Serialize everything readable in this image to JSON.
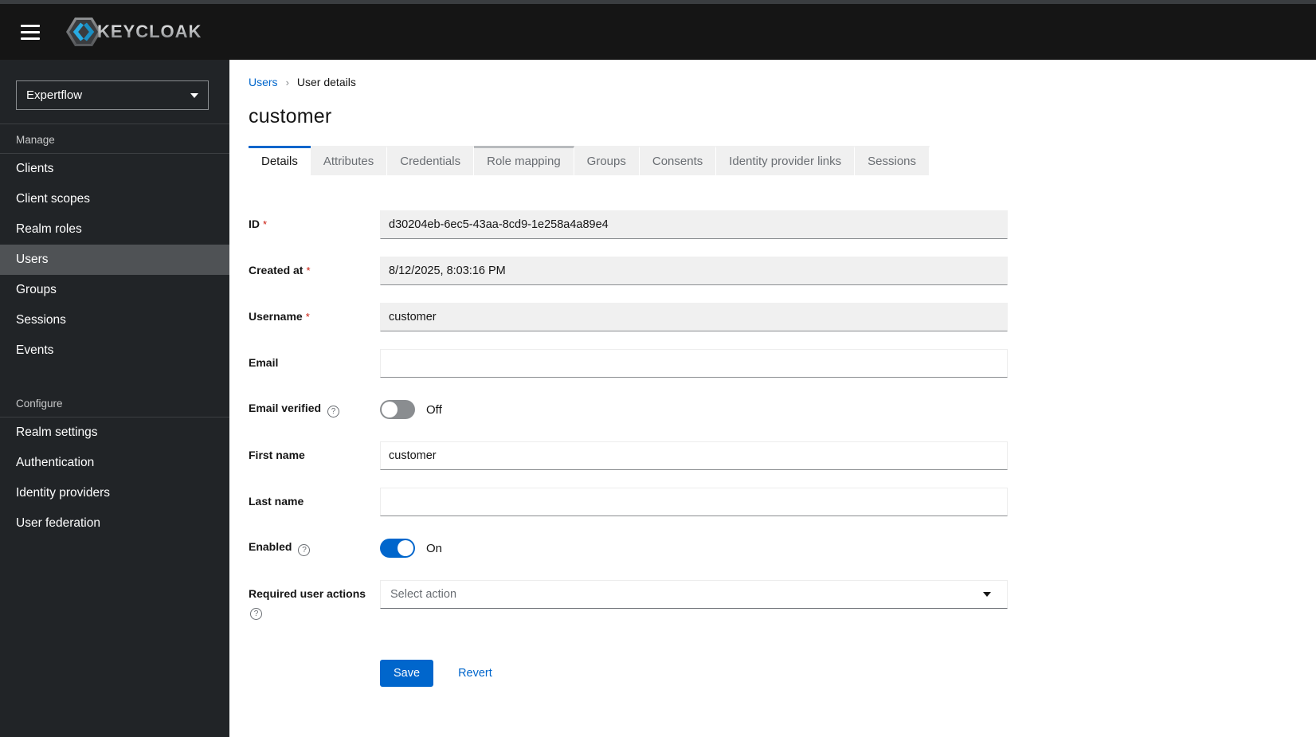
{
  "header": {
    "brand": "KEYCLOAK"
  },
  "sidebar": {
    "realm_selector": {
      "value": "Expertflow"
    },
    "sections": [
      {
        "label": "Manage",
        "items": [
          {
            "label": "Clients",
            "current": false
          },
          {
            "label": "Client scopes",
            "current": false
          },
          {
            "label": "Realm roles",
            "current": false
          },
          {
            "label": "Users",
            "current": true
          },
          {
            "label": "Groups",
            "current": false
          },
          {
            "label": "Sessions",
            "current": false
          },
          {
            "label": "Events",
            "current": false
          }
        ]
      },
      {
        "label": "Configure",
        "items": [
          {
            "label": "Realm settings",
            "current": false
          },
          {
            "label": "Authentication",
            "current": false
          },
          {
            "label": "Identity providers",
            "current": false
          },
          {
            "label": "User federation",
            "current": false
          }
        ]
      }
    ]
  },
  "breadcrumb": {
    "items": [
      {
        "label": "Users",
        "link": true
      },
      {
        "label": "User details",
        "link": false
      }
    ]
  },
  "page": {
    "title": "customer"
  },
  "tabs": [
    {
      "label": "Details",
      "state": "active"
    },
    {
      "label": "Attributes",
      "state": "default"
    },
    {
      "label": "Credentials",
      "state": "default"
    },
    {
      "label": "Role mapping",
      "state": "hover"
    },
    {
      "label": "Groups",
      "state": "default"
    },
    {
      "label": "Consents",
      "state": "default"
    },
    {
      "label": "Identity provider links",
      "state": "default"
    },
    {
      "label": "Sessions",
      "state": "default"
    }
  ],
  "form": {
    "id": {
      "label": "ID",
      "required": "*",
      "value": "d30204eb-6ec5-43aa-8cd9-1e258a4a89e4",
      "disabled": true
    },
    "created_at": {
      "label": "Created at",
      "required": "*",
      "value": "8/12/2025, 8:03:16 PM",
      "disabled": true
    },
    "username": {
      "label": "Username",
      "required": "*",
      "value": "customer",
      "disabled": true
    },
    "email": {
      "label": "Email",
      "value": ""
    },
    "email_verified": {
      "label": "Email verified",
      "state_label": "Off",
      "on": false,
      "help": "?"
    },
    "first_name": {
      "label": "First name",
      "value": "customer"
    },
    "last_name": {
      "label": "Last name",
      "value": ""
    },
    "enabled": {
      "label": "Enabled",
      "state_label": "On",
      "on": true,
      "help": "?"
    },
    "required_user_actions": {
      "label": "Required user actions",
      "placeholder": "Select action",
      "help": "?"
    }
  },
  "actions": {
    "save_label": "Save",
    "revert_label": "Revert"
  },
  "colors": {
    "accent": "#0066cc",
    "masthead": "#151515",
    "sidebar": "#212427",
    "nav_current": "#4f5255",
    "toggle_off": "#8a8d90",
    "required_asterisk": "#c9190b",
    "logo_chevron": "#29abe2"
  }
}
